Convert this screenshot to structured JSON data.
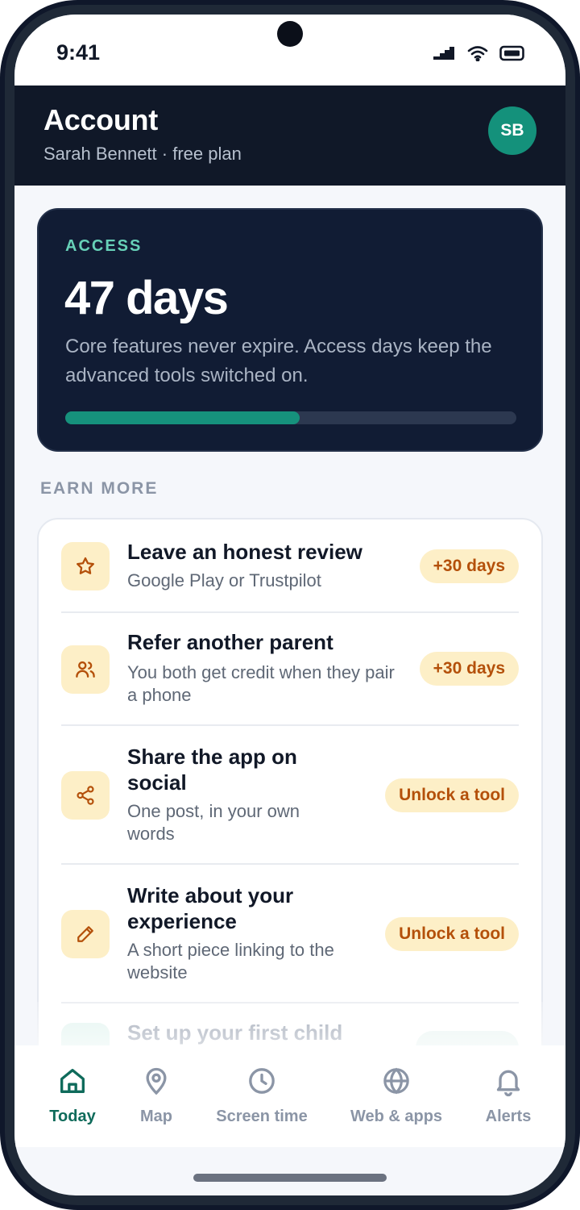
{
  "status_bar": {
    "time": "9:41",
    "icons": [
      "signal-icon",
      "wifi-icon",
      "battery-icon"
    ]
  },
  "header": {
    "title": "Account",
    "subtitle": "Sarah Bennett · free plan",
    "avatar_initials": "SB"
  },
  "access": {
    "label": "ACCESS",
    "days": "47 days",
    "description": "Core features never expire. Access days keep the advanced tools switched on.",
    "progress_fraction": 0.52
  },
  "earn_more": {
    "label": "EARN MORE",
    "items": [
      {
        "title": "Leave an honest review",
        "description": "Google Play or Trustpilot",
        "reward": "+30 days",
        "icon": "star-icon"
      },
      {
        "title": "Refer another parent",
        "description": "You both get credit when they pair a phone",
        "reward": "+30 days",
        "icon": "users-icon"
      },
      {
        "title": "Share the app on social",
        "description": "One post, in your own words",
        "reward": "Unlock a tool",
        "icon": "share-icon"
      },
      {
        "title": "Write about your experience",
        "description": "A short piece linking to the website",
        "reward": "Unlock a tool",
        "icon": "pencil-icon"
      },
      {
        "title": "Set up your first child",
        "description": "",
        "reward": "",
        "icon": "child-icon"
      }
    ]
  },
  "nav": {
    "items": [
      {
        "label": "Today",
        "icon": "home-icon",
        "active": true
      },
      {
        "label": "Map",
        "icon": "map-pin-icon",
        "active": false
      },
      {
        "label": "Screen time",
        "icon": "clock-icon",
        "active": false
      },
      {
        "label": "Web & apps",
        "icon": "globe-icon",
        "active": false
      },
      {
        "label": "Alerts",
        "icon": "bell-icon",
        "active": false
      }
    ]
  },
  "colors": {
    "header_bg": "#101828",
    "accent_teal": "#16917c",
    "badge_bg": "#fdefc7",
    "badge_text": "#b4500a",
    "nav_active": "#0f6b5b"
  }
}
